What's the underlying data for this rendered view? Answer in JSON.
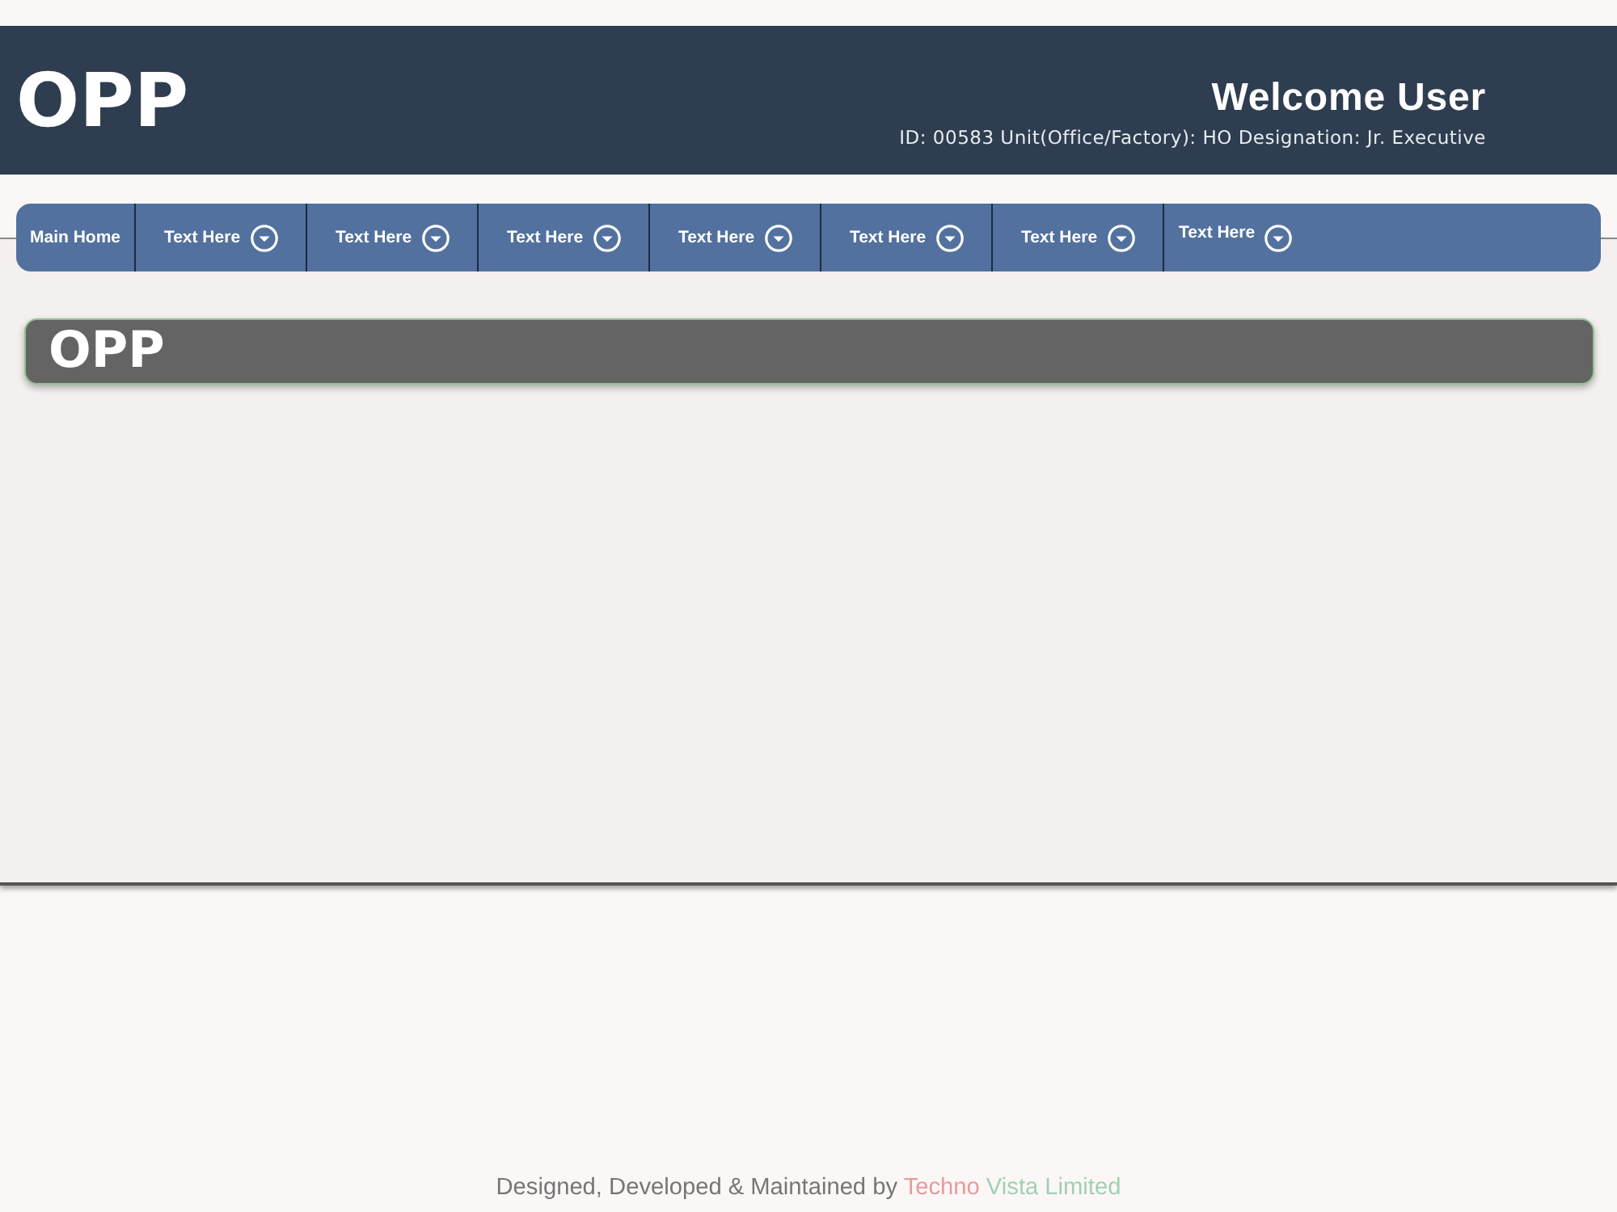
{
  "header": {
    "title": "OPP",
    "welcome": "Welcome User",
    "user_info": "ID: 00583 Unit(Office/Factory): HO Designation: Jr. Executive"
  },
  "nav": {
    "items": [
      {
        "label": "Main Home",
        "kind": "link"
      },
      {
        "label": "Text Here",
        "kind": "dropdown"
      },
      {
        "label": "Text Here",
        "kind": "dropdown"
      },
      {
        "label": "Text Here",
        "kind": "dropdown"
      },
      {
        "label": "Text Here",
        "kind": "dropdown"
      },
      {
        "label": "Text Here",
        "kind": "dropdown"
      },
      {
        "label": "Text Here",
        "kind": "dropdown"
      },
      {
        "label": "Text Here",
        "kind": "dropdown"
      }
    ]
  },
  "panel": {
    "title": "OPP"
  },
  "footer": {
    "parts": [
      {
        "text": "Designed, Developed & Maintained by ",
        "color": "#767676"
      },
      {
        "text": "Techno",
        "color": "#e79b9b"
      },
      {
        "text": " Vista Limited",
        "color": "#9fd1b2"
      }
    ]
  }
}
